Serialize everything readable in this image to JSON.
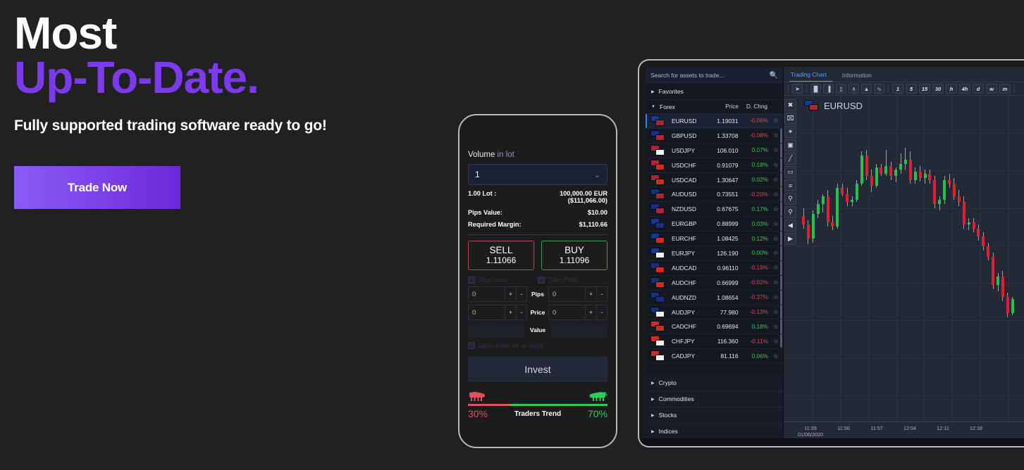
{
  "hero": {
    "line1": "Most",
    "line2": "Up-To-Date.",
    "subtitle": "Fully supported trading software ready to go!",
    "cta_label": "Trade Now",
    "accent_color": "#7c3aed",
    "cta_gradient": [
      "#8b5cf6",
      "#6d28d9"
    ]
  },
  "phone": {
    "volume_label_strong": "Volume",
    "volume_label_dim": " in lot",
    "volume_value": "1",
    "chevron": "⌄",
    "details": [
      {
        "key": "1.00 Lot :",
        "value": "100,000.00 EUR",
        "value2": "($111,066.00)"
      },
      {
        "key": "Pips Value:",
        "value": "$10.00",
        "value2": ""
      },
      {
        "key": "Required Margin:",
        "value": "$1,110.66",
        "value2": ""
      }
    ],
    "sell": {
      "label": "SELL",
      "price": "1.11066",
      "color": "#b5484f"
    },
    "buy": {
      "label": "BUY",
      "price": "1.11096",
      "color": "#3e9b55"
    },
    "checkbox_stop_loss": "Stop Loss",
    "checkbox_take_profit": "Take Profit",
    "spinners": [
      {
        "left_value": "0",
        "mid_label": "Pips",
        "right_value": "0",
        "plus": "+",
        "minus": "-"
      },
      {
        "left_value": "0",
        "mid_label": "Price",
        "right_value": "0",
        "plus": "+",
        "minus": "-"
      }
    ],
    "value_label": "Value",
    "checkbox_open_all": "Open trade on all splits",
    "invest_label": "Invest",
    "trend": {
      "bear_icon": "bear-icon",
      "bull_icon": "bull-icon",
      "left_pct": "30%",
      "label": "Traders Trend",
      "right_pct": "70%",
      "left_value": 30,
      "right_value": 70,
      "left_color": "#e05260",
      "right_color": "#2ecc57"
    }
  },
  "desktop": {
    "search_placeholder": "Search for assets to trade...",
    "search_icon": "search-icon",
    "favorites_label": "Favorites",
    "forex_label": "Forex",
    "col_price": "Price",
    "col_change": "D. Chng",
    "assets": [
      {
        "symbol": "EURUSD",
        "price": "1.19031",
        "change": "-0.06%",
        "dir": "down",
        "selected": true,
        "f1": "eu",
        "f2": "us"
      },
      {
        "symbol": "GBPUSD",
        "price": "1.33708",
        "change": "-0.08%",
        "dir": "down",
        "selected": false,
        "f1": "gb",
        "f2": "us"
      },
      {
        "symbol": "USDJPY",
        "price": "106.010",
        "change": "0.07%",
        "dir": "up",
        "selected": false,
        "f1": "us",
        "f2": "jp"
      },
      {
        "symbol": "USDCHF",
        "price": "0.91079",
        "change": "0.18%",
        "dir": "up",
        "selected": false,
        "f1": "us",
        "f2": "ch"
      },
      {
        "symbol": "USDCAD",
        "price": "1.30647",
        "change": "0.02%",
        "dir": "up",
        "selected": false,
        "f1": "us",
        "f2": "ca"
      },
      {
        "symbol": "AUDUSD",
        "price": "0.73551",
        "change": "-0.20%",
        "dir": "down",
        "selected": false,
        "f1": "au",
        "f2": "us"
      },
      {
        "symbol": "NZDUSD",
        "price": "0.67675",
        "change": "0.17%",
        "dir": "up",
        "selected": false,
        "f1": "nz",
        "f2": "us"
      },
      {
        "symbol": "EURGBP",
        "price": "0.88999",
        "change": "0.03%",
        "dir": "up",
        "selected": false,
        "f1": "eu",
        "f2": "gb"
      },
      {
        "symbol": "EURCHF",
        "price": "1.08425",
        "change": "0.12%",
        "dir": "up",
        "selected": false,
        "f1": "eu",
        "f2": "ch"
      },
      {
        "symbol": "EURJPY",
        "price": "126.190",
        "change": "0.00%",
        "dir": "up",
        "selected": false,
        "f1": "eu",
        "f2": "jp"
      },
      {
        "symbol": "AUDCAD",
        "price": "0.96110",
        "change": "-0.19%",
        "dir": "down",
        "selected": false,
        "f1": "au",
        "f2": "ca"
      },
      {
        "symbol": "AUDCHF",
        "price": "0.66999",
        "change": "-0.02%",
        "dir": "down",
        "selected": false,
        "f1": "au",
        "f2": "ch"
      },
      {
        "symbol": "AUDNZD",
        "price": "1.08654",
        "change": "-0.37%",
        "dir": "down",
        "selected": false,
        "f1": "au",
        "f2": "nz"
      },
      {
        "symbol": "AUDJPY",
        "price": "77.980",
        "change": "-0.13%",
        "dir": "down",
        "selected": false,
        "f1": "au",
        "f2": "jp"
      },
      {
        "symbol": "CADCHF",
        "price": "0.69694",
        "change": "0.18%",
        "dir": "up",
        "selected": false,
        "f1": "ca",
        "f2": "ch"
      },
      {
        "symbol": "CHFJPY",
        "price": "116.360",
        "change": "-0.11%",
        "dir": "down",
        "selected": false,
        "f1": "ch",
        "f2": "jp"
      },
      {
        "symbol": "CADJPY",
        "price": "81.116",
        "change": "0.06%",
        "dir": "up",
        "selected": false,
        "f1": "ca",
        "f2": "jp"
      }
    ],
    "bottom_groups": [
      "Crypto",
      "Commodities",
      "Stocks",
      "Indices"
    ],
    "tabs": [
      {
        "label": "Trading Chart",
        "active": true
      },
      {
        "label": "Information",
        "active": false
      }
    ],
    "chart_tools": [
      "cursor-icon",
      "candlestick-icon",
      "bar-chart-icon",
      "hollow-candle-icon",
      "line-chart-icon",
      "area-chart-icon",
      "baseline-icon"
    ],
    "timeframes": [
      "1",
      "5",
      "15",
      "30",
      "h",
      "4h",
      "d",
      "w",
      "m"
    ],
    "left_rail_tools": [
      "close-icon",
      "crosshair-remove-icon",
      "magnet-icon",
      "lock-icon",
      "pencil-icon",
      "rectangle-icon",
      "lines-icon",
      "zoom-in-icon",
      "zoom-out-icon",
      "collapse-left-icon",
      "expand-right-icon"
    ],
    "symbol_name": "EURUSD",
    "symbol_flags": [
      "eu",
      "us"
    ]
  },
  "chart_data": {
    "type": "candlestick",
    "title": "EURUSD",
    "xlabel": "",
    "ylabel": "",
    "grid": true,
    "legend": false,
    "x_tick_labels": [
      "11:39",
      "11:50",
      "11:57",
      "12:04",
      "12:11",
      "12:18"
    ],
    "x_tick_sublabel": "01/06/2020",
    "timeframe": "1",
    "up_color": "#27c04a",
    "down_color": "#e02030",
    "candles": [
      {
        "o": 0.5,
        "h": 0.54,
        "l": 0.44,
        "c": 0.46,
        "dir": "down"
      },
      {
        "o": 0.46,
        "h": 0.48,
        "l": 0.36,
        "c": 0.39,
        "dir": "down"
      },
      {
        "o": 0.39,
        "h": 0.53,
        "l": 0.37,
        "c": 0.51,
        "dir": "up"
      },
      {
        "o": 0.51,
        "h": 0.58,
        "l": 0.49,
        "c": 0.56,
        "dir": "up"
      },
      {
        "o": 0.56,
        "h": 0.61,
        "l": 0.52,
        "c": 0.6,
        "dir": "up"
      },
      {
        "o": 0.6,
        "h": 0.63,
        "l": 0.45,
        "c": 0.47,
        "dir": "down"
      },
      {
        "o": 0.47,
        "h": 0.5,
        "l": 0.43,
        "c": 0.45,
        "dir": "down"
      },
      {
        "o": 0.45,
        "h": 0.66,
        "l": 0.44,
        "c": 0.64,
        "dir": "up"
      },
      {
        "o": 0.64,
        "h": 0.66,
        "l": 0.6,
        "c": 0.61,
        "dir": "down"
      },
      {
        "o": 0.61,
        "h": 0.64,
        "l": 0.55,
        "c": 0.57,
        "dir": "down"
      },
      {
        "o": 0.57,
        "h": 0.6,
        "l": 0.55,
        "c": 0.58,
        "dir": "up"
      },
      {
        "o": 0.58,
        "h": 0.68,
        "l": 0.57,
        "c": 0.66,
        "dir": "up"
      },
      {
        "o": 0.66,
        "h": 0.82,
        "l": 0.65,
        "c": 0.8,
        "dir": "up"
      },
      {
        "o": 0.8,
        "h": 0.83,
        "l": 0.68,
        "c": 0.7,
        "dir": "down"
      },
      {
        "o": 0.7,
        "h": 0.73,
        "l": 0.62,
        "c": 0.65,
        "dir": "down"
      },
      {
        "o": 0.65,
        "h": 0.76,
        "l": 0.64,
        "c": 0.74,
        "dir": "up"
      },
      {
        "o": 0.74,
        "h": 0.76,
        "l": 0.7,
        "c": 0.71,
        "dir": "down"
      },
      {
        "o": 0.71,
        "h": 0.83,
        "l": 0.7,
        "c": 0.75,
        "dir": "up"
      },
      {
        "o": 0.75,
        "h": 0.77,
        "l": 0.68,
        "c": 0.7,
        "dir": "down"
      },
      {
        "o": 0.7,
        "h": 0.74,
        "l": 0.67,
        "c": 0.73,
        "dir": "up"
      },
      {
        "o": 0.73,
        "h": 0.81,
        "l": 0.71,
        "c": 0.76,
        "dir": "up"
      },
      {
        "o": 0.76,
        "h": 0.84,
        "l": 0.73,
        "c": 0.78,
        "dir": "up"
      },
      {
        "o": 0.78,
        "h": 0.82,
        "l": 0.66,
        "c": 0.68,
        "dir": "down"
      },
      {
        "o": 0.68,
        "h": 0.74,
        "l": 0.66,
        "c": 0.72,
        "dir": "up"
      },
      {
        "o": 0.72,
        "h": 0.75,
        "l": 0.67,
        "c": 0.69,
        "dir": "down"
      },
      {
        "o": 0.69,
        "h": 0.73,
        "l": 0.66,
        "c": 0.71,
        "dir": "up"
      },
      {
        "o": 0.71,
        "h": 0.73,
        "l": 0.66,
        "c": 0.68,
        "dir": "down"
      },
      {
        "o": 0.68,
        "h": 0.7,
        "l": 0.54,
        "c": 0.56,
        "dir": "down"
      },
      {
        "o": 0.56,
        "h": 0.6,
        "l": 0.53,
        "c": 0.58,
        "dir": "up"
      },
      {
        "o": 0.58,
        "h": 0.7,
        "l": 0.56,
        "c": 0.68,
        "dir": "up"
      },
      {
        "o": 0.68,
        "h": 0.71,
        "l": 0.64,
        "c": 0.66,
        "dir": "down"
      },
      {
        "o": 0.66,
        "h": 0.69,
        "l": 0.58,
        "c": 0.6,
        "dir": "down"
      },
      {
        "o": 0.6,
        "h": 0.63,
        "l": 0.55,
        "c": 0.57,
        "dir": "down"
      },
      {
        "o": 0.57,
        "h": 0.6,
        "l": 0.44,
        "c": 0.46,
        "dir": "down"
      },
      {
        "o": 0.46,
        "h": 0.49,
        "l": 0.43,
        "c": 0.47,
        "dir": "up"
      },
      {
        "o": 0.47,
        "h": 0.49,
        "l": 0.42,
        "c": 0.44,
        "dir": "down"
      },
      {
        "o": 0.44,
        "h": 0.46,
        "l": 0.38,
        "c": 0.4,
        "dir": "down"
      },
      {
        "o": 0.4,
        "h": 0.42,
        "l": 0.33,
        "c": 0.35,
        "dir": "down"
      },
      {
        "o": 0.35,
        "h": 0.37,
        "l": 0.28,
        "c": 0.3,
        "dir": "down"
      },
      {
        "o": 0.3,
        "h": 0.32,
        "l": 0.14,
        "c": 0.16,
        "dir": "down"
      },
      {
        "o": 0.16,
        "h": 0.22,
        "l": 0.13,
        "c": 0.2,
        "dir": "up"
      },
      {
        "o": 0.2,
        "h": 0.23,
        "l": 0.08,
        "c": 0.1,
        "dir": "down"
      },
      {
        "o": 0.1,
        "h": 0.12,
        "l": 0.0,
        "c": 0.02,
        "dir": "down"
      },
      {
        "o": 0.02,
        "h": 0.1,
        "l": 0.01,
        "c": 0.09,
        "dir": "up"
      }
    ]
  }
}
